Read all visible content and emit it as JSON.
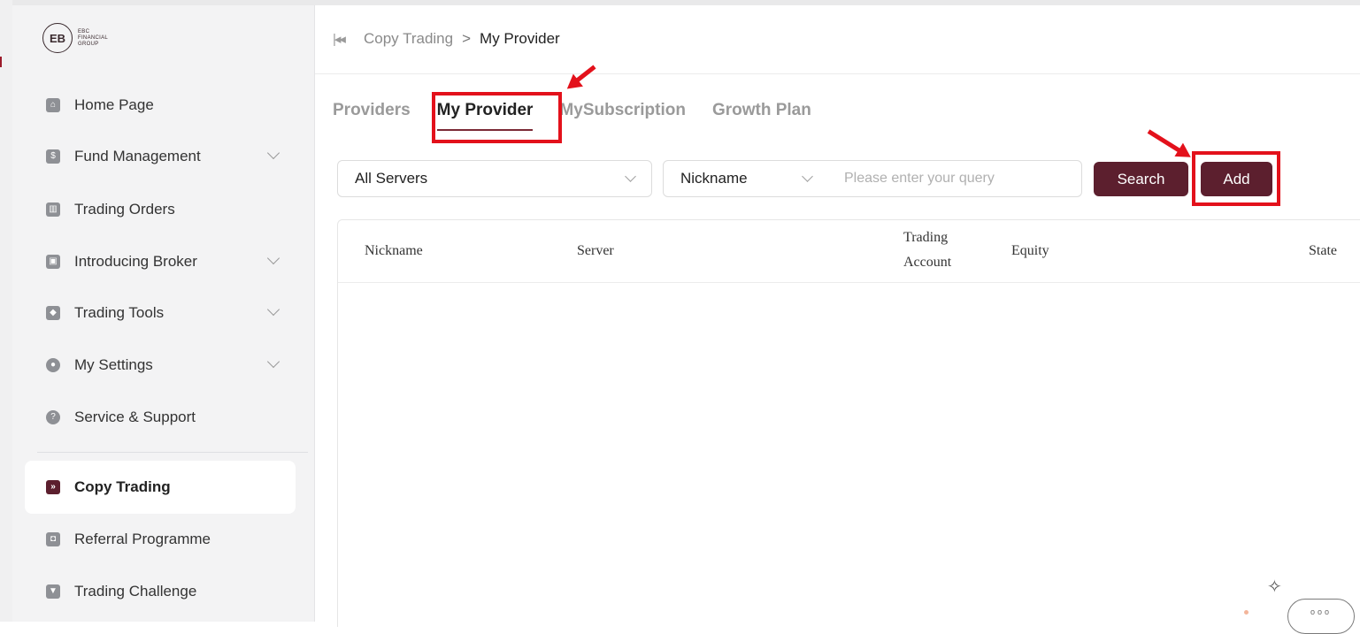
{
  "logo": {
    "mark": "EB",
    "line1": "EBC",
    "line2": "FINANCIAL",
    "line3": "GROUP"
  },
  "sidebar": {
    "items": [
      {
        "label": "Home Page",
        "icon": "home-icon"
      },
      {
        "label": "Fund Management",
        "icon": "fund-icon"
      },
      {
        "label": "Trading Orders",
        "icon": "chart-icon"
      },
      {
        "label": "Introducing Broker",
        "icon": "broker-icon"
      },
      {
        "label": "Trading Tools",
        "icon": "toolbox-icon"
      },
      {
        "label": "My Settings",
        "icon": "user-icon"
      },
      {
        "label": "Service & Support",
        "icon": "help-icon"
      },
      {
        "label": "Copy Trading",
        "icon": "copy-trading-icon"
      },
      {
        "label": "Referral Programme",
        "icon": "referral-icon"
      },
      {
        "label": "Trading Challenge",
        "icon": "trophy-icon"
      }
    ]
  },
  "breadcrumb": {
    "back_icon": "|◂◂",
    "parent": "Copy Trading",
    "separator": ">",
    "current": "My Provider"
  },
  "tabs": [
    {
      "label": "Providers"
    },
    {
      "label": "My Provider"
    },
    {
      "label": "MySubscription"
    },
    {
      "label": "Growth Plan"
    }
  ],
  "filters": {
    "server": "All Servers",
    "field": "Nickname",
    "query_placeholder": "Please enter your query",
    "search_label": "Search",
    "add_label": "Add"
  },
  "table": {
    "columns": [
      "Nickname",
      "Server",
      "Trading",
      "Account",
      "Equity",
      "State"
    ]
  },
  "annotations": {
    "highlight_color": "#e3111b"
  },
  "colors": {
    "accent": "#5c1f2e",
    "highlight": "#e3111b"
  },
  "chat": {
    "dots": "ooo"
  },
  "float": {
    "star": "✧"
  }
}
